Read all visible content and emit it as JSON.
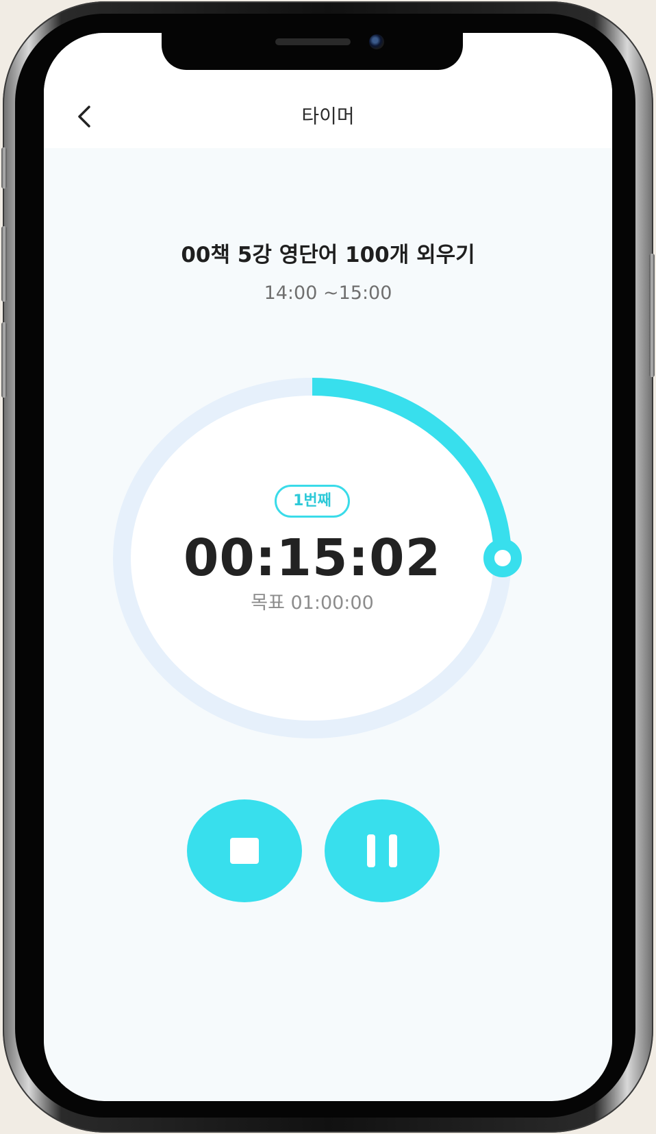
{
  "header": {
    "title": "타이머",
    "back_icon": "chevron-left-icon"
  },
  "task": {
    "title": "00책 5강 영단어 100개 외우기",
    "time_range": "14:00 ~15:00"
  },
  "timer": {
    "round_badge": "1번째",
    "elapsed": "00:15:02",
    "goal": "목표 01:00:00",
    "progress_fraction": 0.25
  },
  "controls": {
    "stop_icon": "stop-icon",
    "pause_icon": "pause-icon"
  },
  "colors": {
    "accent": "#38dfed",
    "ring_track": "#e6f0fb",
    "screen_bg": "#f6fafc"
  }
}
